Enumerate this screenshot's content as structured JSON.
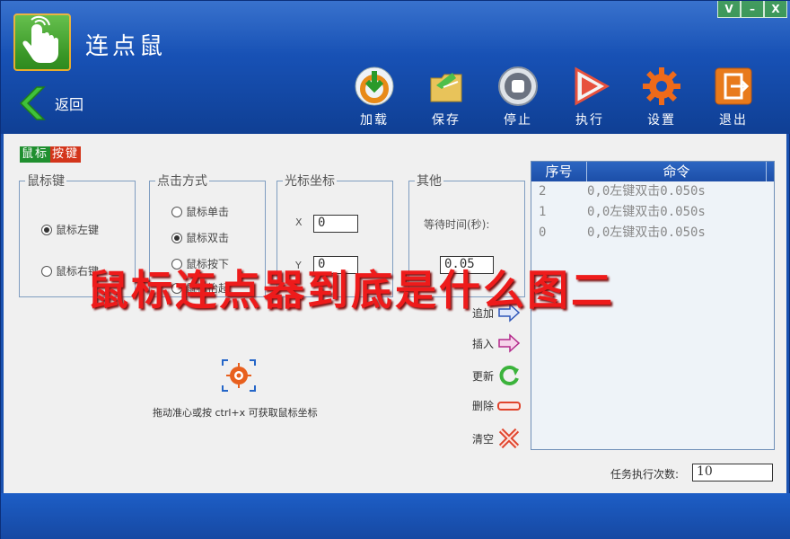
{
  "window": {
    "title": "连点鼠",
    "controls": [
      "V",
      "–",
      "X"
    ]
  },
  "nav": {
    "back_label": "返回"
  },
  "toolbar": [
    {
      "label": "加载",
      "icon": "load-icon"
    },
    {
      "label": "保存",
      "icon": "save-icon"
    },
    {
      "label": "停止",
      "icon": "stop-icon"
    },
    {
      "label": "执行",
      "icon": "play-icon"
    },
    {
      "label": "设置",
      "icon": "gear-icon"
    },
    {
      "label": "退出",
      "icon": "exit-icon"
    }
  ],
  "tab_tag": [
    "鼠标",
    "按键"
  ],
  "mouse_key": {
    "title": "鼠标键",
    "options": [
      "鼠标左键",
      "鼠标右键"
    ],
    "selected": "鼠标左键"
  },
  "click_mode": {
    "title": "点击方式",
    "options": [
      "鼠标单击",
      "鼠标双击",
      "鼠标按下",
      "鼠标抬起"
    ],
    "selected": "鼠标双击"
  },
  "cursor": {
    "title": "光标坐标",
    "x_label": "X",
    "x_value": "0",
    "y_label": "Y",
    "y_value": "0"
  },
  "other": {
    "title": "其他",
    "wait_label": "等待时间(秒):",
    "wait_value": "0.05"
  },
  "commands": {
    "headers": [
      "序号",
      "命令"
    ],
    "rows": [
      {
        "index": "2",
        "command": "0,0左键双击0.050s"
      },
      {
        "index": "1",
        "command": "0,0左键双击0.050s"
      },
      {
        "index": "0",
        "command": "0,0左键双击0.050s"
      }
    ]
  },
  "actions": [
    {
      "label": "追加",
      "icon": "append-arrow-icon"
    },
    {
      "label": "插入",
      "icon": "insert-arrow-icon"
    },
    {
      "label": "更新",
      "icon": "refresh-icon"
    },
    {
      "label": "删除",
      "icon": "delete-icon"
    },
    {
      "label": "清空",
      "icon": "clear-x-icon"
    }
  ],
  "hint": "拖动准心或按 ctrl+x 可获取鼠标坐标",
  "task": {
    "label": "任务执行次数:",
    "value": "10"
  },
  "overlay_text": "鼠标连点器到底是什么图二",
  "colors": {
    "title_bar": "#1750b3",
    "accent_green": "#1f8f2f",
    "accent_red": "#d3351b",
    "overlay_red": "#ee1b1b"
  }
}
